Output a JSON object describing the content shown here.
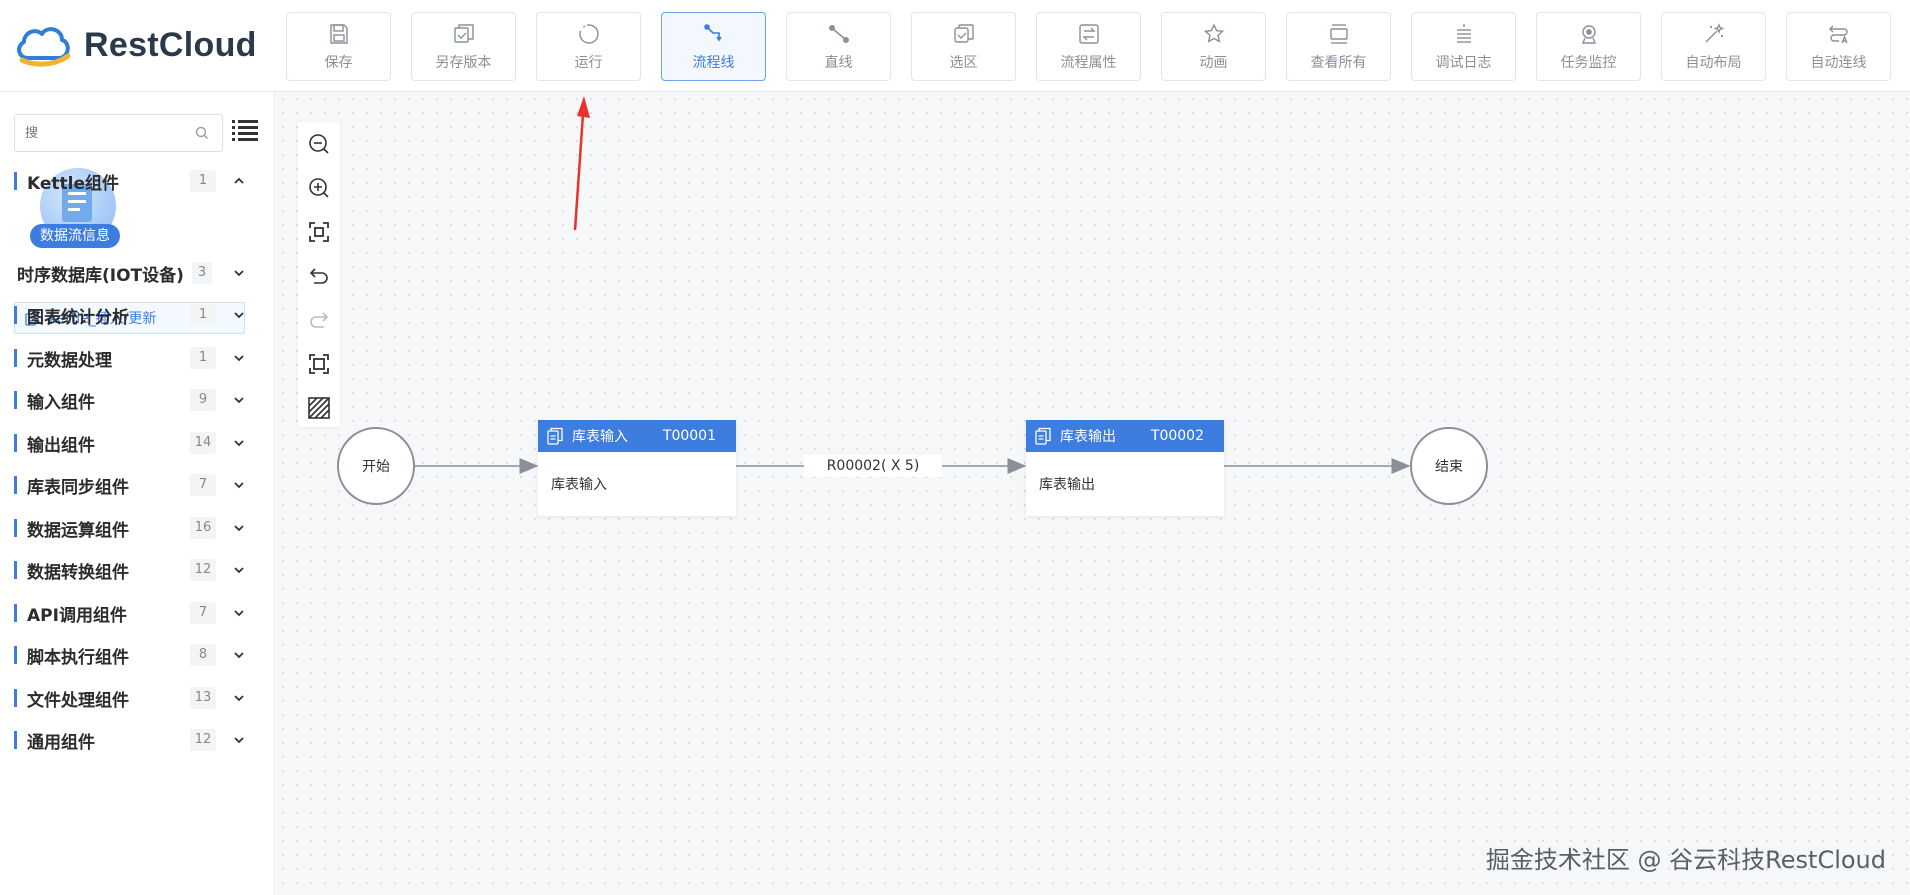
{
  "app": {
    "logo_text": "RestCloud"
  },
  "toolbar": [
    {
      "label": "保存",
      "icon": "save-icon"
    },
    {
      "label": "另存版本",
      "icon": "save-version-icon"
    },
    {
      "label": "运行",
      "icon": "run-icon"
    },
    {
      "label": "流程线",
      "icon": "flow-line-icon",
      "active": true
    },
    {
      "label": "直线",
      "icon": "straight-line-icon"
    },
    {
      "label": "选区",
      "icon": "select-area-icon"
    },
    {
      "label": "流程属性",
      "icon": "flow-properties-icon"
    },
    {
      "label": "动画",
      "icon": "animation-icon"
    },
    {
      "label": "查看所有",
      "icon": "view-all-icon"
    },
    {
      "label": "调试日志",
      "icon": "debug-log-icon"
    },
    {
      "label": "任务监控",
      "icon": "task-monitor-icon"
    },
    {
      "label": "自动布局",
      "icon": "auto-layout-icon"
    },
    {
      "label": "自动连线",
      "icon": "auto-connect-icon"
    }
  ],
  "sidebar": {
    "search": {
      "placeholder": "搜"
    },
    "floating_label": "数据流信息",
    "categories": [
      {
        "name": "Kettle组件",
        "count": "1",
        "expanded": true
      },
      {
        "name": "时序数据库(IOT设备)",
        "count": "3"
      },
      {
        "name": "图表统计分析",
        "count": "1"
      },
      {
        "name": "元数据处理",
        "count": "1"
      },
      {
        "name": "输入组件",
        "count": "9"
      },
      {
        "name": "输出组件",
        "count": "14"
      },
      {
        "name": "库表同步组件",
        "count": "7"
      },
      {
        "name": "数据运算组件",
        "count": "16"
      },
      {
        "name": "数据转换组件",
        "count": "12"
      },
      {
        "name": "API调用组件",
        "count": "7"
      },
      {
        "name": "脚本执行组件",
        "count": "8"
      },
      {
        "name": "文件处理组件",
        "count": "13"
      },
      {
        "name": "通用组件",
        "count": "12"
      }
    ],
    "kettle_sub_item": "kettle_插入/更新"
  },
  "canvas": {
    "start_label": "开始",
    "end_label": "结束",
    "nodes": [
      {
        "title": "库表输入",
        "code": "T00001",
        "body": "库表输入"
      },
      {
        "title": "库表输出",
        "code": "T00002",
        "body": "库表输出"
      }
    ],
    "edge_label": "R00002( X 5)"
  },
  "watermark": "掘金技术社区 @ 谷云科技RestCloud",
  "colors": {
    "accent": "#3d7de0",
    "annotation": "#e8322b"
  }
}
